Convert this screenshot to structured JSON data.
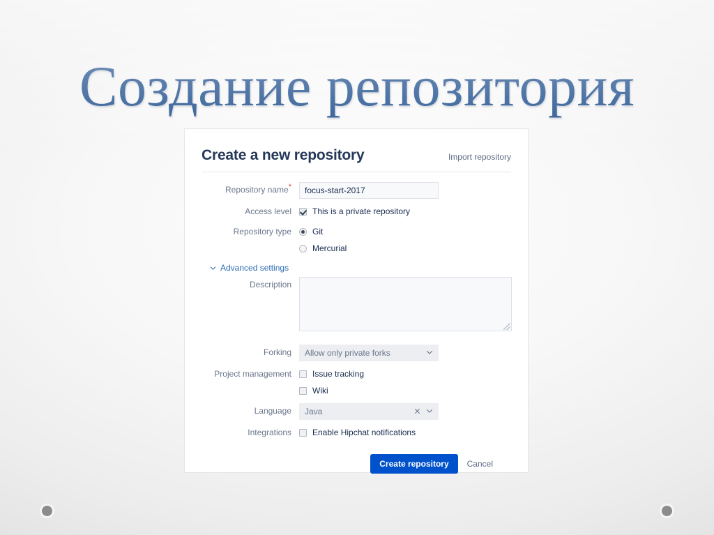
{
  "slide": {
    "title": "Создание репозитория",
    "accent_title_color": "#245390",
    "background_color": "#f2f2f2",
    "dot_color": "#8c8c8c"
  },
  "card": {
    "heading": "Create a new repository",
    "import_link": "Import repository",
    "primary_color": "#0052cc",
    "fields": {
      "repository_name": {
        "label": "Repository name",
        "required_marker": "*",
        "value": "focus-start-2017"
      },
      "access_level": {
        "label": "Access level",
        "checkbox_label": "This is a private repository",
        "checked": true
      },
      "repository_type": {
        "label": "Repository type",
        "options": [
          {
            "label": "Git",
            "selected": true
          },
          {
            "label": "Mercurial",
            "selected": false
          }
        ]
      },
      "advanced_settings": {
        "label": "Advanced settings",
        "chevron_icon": "chevron-down-icon",
        "expanded": true
      },
      "description": {
        "label": "Description",
        "value": "",
        "placeholder": ""
      },
      "forking": {
        "label": "Forking",
        "value": "Allow only private forks",
        "chevron_icon": "chevron-down-icon"
      },
      "project_management": {
        "label": "Project management",
        "options": [
          {
            "label": "Issue tracking",
            "checked": false
          },
          {
            "label": "Wiki",
            "checked": false
          }
        ]
      },
      "language": {
        "label": "Language",
        "value": "Java",
        "clear_icon": "close-icon",
        "chevron_icon": "chevron-down-icon"
      },
      "integrations": {
        "label": "Integrations",
        "checkbox_label": "Enable Hipchat notifications",
        "checked": false
      }
    },
    "actions": {
      "submit_label": "Create repository",
      "cancel_label": "Cancel"
    }
  }
}
